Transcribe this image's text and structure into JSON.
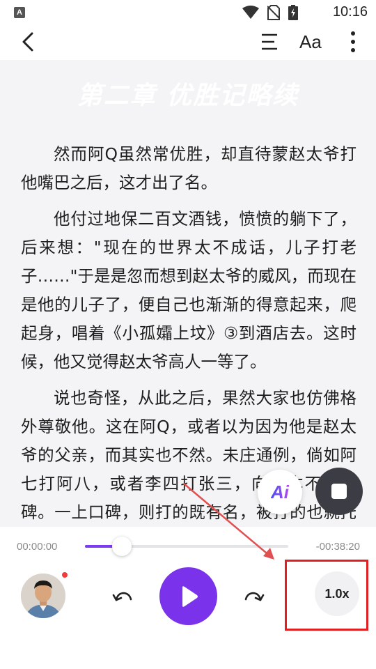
{
  "status_bar": {
    "app_badge": "A",
    "time": "10:16"
  },
  "toolbar": {
    "back_icon": "chevron-left-icon",
    "toc_icon": "table-of-contents-icon",
    "font_label": "Aa",
    "more_icon": "more-vertical-icon"
  },
  "reader": {
    "chapter_title": "第二章 优胜记略续",
    "paragraphs": [
      "然而阿Q虽然常优胜，却直待蒙赵太爷打他嘴巴之后，这才出了名。",
      "他付过地保二百文酒钱，愤愤的躺下了，后来想：\"现在的世界太不成话，儿子打老子……\"于是是忽而想到赵太爷的威风，而现在是他的儿子了，便自己也渐渐的得意起来，爬起身，唱着《小孤孀上坟》③到酒店去。这时候，他又觉得赵太爷高人一等了。",
      "说也奇怪，从此之后，果然大家也仿佛格外尊敬他。这在阿Q，或者以为因为他是赵太爷的父亲，而其实也不然。未庄通例，倘如阿七打阿八，或者李四打张三，向来本不算口碑。一上口碑，则打的既有名，被打的也就托庇有了名。至于错在阿Q，那自然是不必说。"
    ]
  },
  "floating": {
    "ai_label": "Ai",
    "stop_icon": "stop-icon"
  },
  "player": {
    "time_elapsed": "00:00:00",
    "time_remaining": "-00:38:20",
    "progress": 0.18,
    "speed_label": "1.0x",
    "rewind_icon": "rewind-icon",
    "play_icon": "play-icon",
    "forward_icon": "forward-icon"
  },
  "colors": {
    "accent": "#7a32ea",
    "annotation": "#e02020"
  }
}
